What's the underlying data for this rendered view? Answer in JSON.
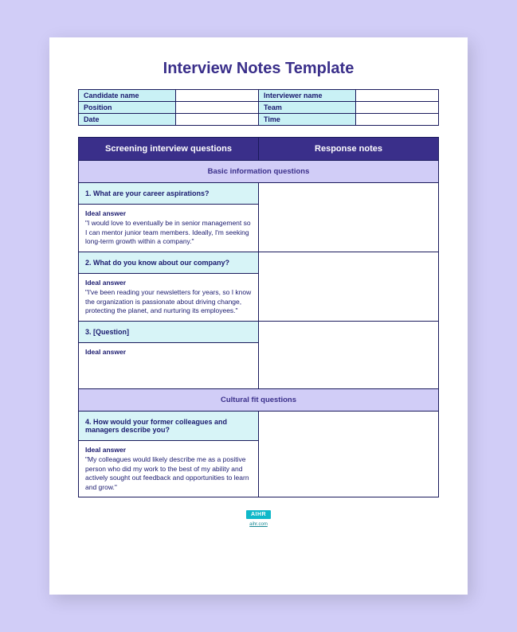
{
  "title": "Interview Notes Template",
  "info": {
    "candidate_name_label": "Candidate name",
    "interviewer_name_label": "Interviewer name",
    "position_label": "Position",
    "team_label": "Team",
    "date_label": "Date",
    "time_label": "Time",
    "candidate_name": "",
    "interviewer_name": "",
    "position": "",
    "team": "",
    "date": "",
    "time": ""
  },
  "headers": {
    "questions": "Screening interview questions",
    "notes": "Response notes"
  },
  "sections": {
    "basic": "Basic information questions",
    "cultural": "Cultural fit questions"
  },
  "ideal_label": "Ideal answer",
  "questions": {
    "q1": {
      "text": "1. What are your career aspirations?",
      "ideal": "\"I would love to eventually be in senior management so I can mentor junior team members. Ideally, I'm seeking long-term growth within a company.\""
    },
    "q2": {
      "text": "2. What do you know about our company?",
      "ideal": "\"I've been reading your newsletters for years, so I know the organization is passionate about driving change, protecting the planet, and nurturing its employees.\""
    },
    "q3": {
      "text": "3. [Question]",
      "ideal": ""
    },
    "q4": {
      "text": "4. How would your former colleagues and managers describe you?",
      "ideal": "\"My colleagues would likely describe me as a positive person who did my work to the best of my ability and actively sought out feedback and opportunities to learn and grow.\""
    }
  },
  "footer": {
    "logo": "AIHR",
    "link": "aihr.com"
  }
}
